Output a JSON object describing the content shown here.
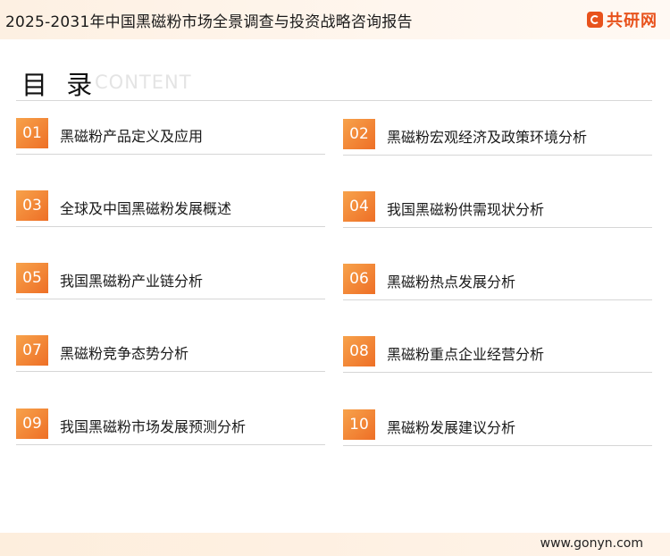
{
  "header": {
    "title": "2025-2031年中国黑磁粉市场全景调查与投资战略咨询报告",
    "logo_text": "共研网",
    "logo_icon": "g-logo-icon",
    "accent": "#e8521c"
  },
  "toc": {
    "title": "目 录",
    "subtitle": "CONTENT"
  },
  "items": [
    {
      "num": "01",
      "label": "黑磁粉产品定义及应用"
    },
    {
      "num": "02",
      "label": "黑磁粉宏观经济及政策环境分析"
    },
    {
      "num": "03",
      "label": "全球及中国黑磁粉发展概述"
    },
    {
      "num": "04",
      "label": "我国黑磁粉供需现状分析"
    },
    {
      "num": "05",
      "label": "我国黑磁粉产业链分析"
    },
    {
      "num": "06",
      "label": "黑磁粉热点发展分析"
    },
    {
      "num": "07",
      "label": "黑磁粉竞争态势分析"
    },
    {
      "num": "08",
      "label": "黑磁粉重点企业经营分析"
    },
    {
      "num": "09",
      "label": "我国黑磁粉市场发展预测分析"
    },
    {
      "num": "10",
      "label": "黑磁粉发展建议分析"
    }
  ],
  "footer": {
    "url": "www.gonyn.com"
  }
}
